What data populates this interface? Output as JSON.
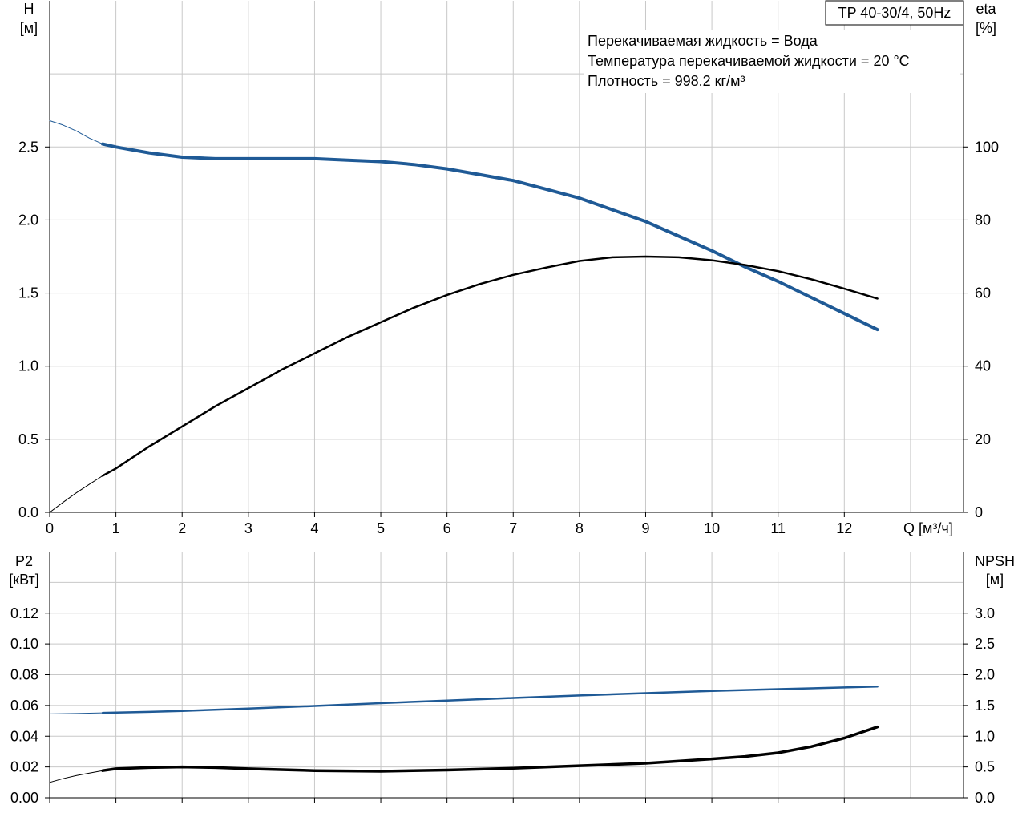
{
  "chart_data": [
    {
      "type": "line",
      "title_box": "TP 40-30/4, 50Hz",
      "notes": [
        "Перекачиваемая жидкость = Вода",
        "Температура перекачиваемой жидкости = 20 °C",
        "Плотность = 998.2 кг/м³"
      ],
      "xlabel": "Q [м³/ч]",
      "xlim": [
        0,
        13.8
      ],
      "xticks": [
        0,
        1,
        2,
        3,
        4,
        5,
        6,
        7,
        8,
        9,
        10,
        11,
        12
      ],
      "left_axis": {
        "label_top": "H",
        "label_unit": "[м]",
        "lim": [
          0,
          3.5
        ],
        "ticks": [
          "0.0",
          "0.5",
          "1.0",
          "1.5",
          "2.0",
          "2.5"
        ],
        "tick_values": [
          0,
          0.5,
          1.0,
          1.5,
          2.0,
          2.5
        ]
      },
      "right_axis": {
        "label_top": "eta",
        "label_unit": "[%]",
        "lim": [
          0,
          140
        ],
        "ticks": [
          "0",
          "20",
          "40",
          "60",
          "80",
          "100"
        ],
        "tick_values": [
          0,
          20,
          40,
          60,
          80,
          100
        ]
      },
      "grid": true,
      "series": [
        {
          "axis": "left",
          "color": "#1f5a96",
          "width": 4,
          "x": [
            0.8,
            1.0,
            1.5,
            2.0,
            2.5,
            3.0,
            3.5,
            4.0,
            4.5,
            5.0,
            5.5,
            6.0,
            6.5,
            7.0,
            7.5,
            8.0,
            8.5,
            9.0,
            9.5,
            10.0,
            10.5,
            11.0,
            11.5,
            12.0,
            12.5
          ],
          "values": [
            2.52,
            2.5,
            2.46,
            2.43,
            2.42,
            2.42,
            2.42,
            2.42,
            2.41,
            2.4,
            2.38,
            2.35,
            2.31,
            2.27,
            2.21,
            2.15,
            2.07,
            1.99,
            1.89,
            1.79,
            1.68,
            1.58,
            1.47,
            1.36,
            1.25
          ]
        },
        {
          "axis": "left",
          "color": "#1f5a96",
          "width": 1,
          "x": [
            0,
            0.2,
            0.4,
            0.6,
            0.8
          ],
          "values": [
            2.68,
            2.65,
            2.61,
            2.56,
            2.52
          ]
        },
        {
          "axis": "right",
          "color": "#000000",
          "width": 2.5,
          "x": [
            0.8,
            1.0,
            1.5,
            2.0,
            2.5,
            3.0,
            3.5,
            4.0,
            4.5,
            5.0,
            5.5,
            6.0,
            6.5,
            7.0,
            7.5,
            8.0,
            8.5,
            9.0,
            9.5,
            10.0,
            10.5,
            11.0,
            11.5,
            12.0,
            12.5
          ],
          "values": [
            10,
            12,
            18,
            23.5,
            29,
            34,
            39,
            43.5,
            48,
            52,
            56,
            59.5,
            62.5,
            65,
            67,
            68.8,
            69.8,
            70.0,
            69.8,
            69,
            67.7,
            66,
            63.8,
            61.2,
            58.5
          ]
        },
        {
          "axis": "right",
          "color": "#000000",
          "width": 1,
          "x": [
            0,
            0.2,
            0.4,
            0.6,
            0.8
          ],
          "values": [
            0,
            2.7,
            5.3,
            7.7,
            10
          ]
        }
      ]
    },
    {
      "type": "line",
      "xlim": [
        0,
        13.8
      ],
      "xticks": [
        0,
        1,
        2,
        3,
        4,
        5,
        6,
        7,
        8,
        9,
        10,
        11,
        12
      ],
      "left_axis": {
        "label_top": "P2",
        "label_unit": "[кВт]",
        "lim": [
          0,
          0.16
        ],
        "ticks": [
          "0.00",
          "0.02",
          "0.04",
          "0.06",
          "0.08",
          "0.10",
          "0.12"
        ],
        "tick_values": [
          0,
          0.02,
          0.04,
          0.06,
          0.08,
          0.1,
          0.12
        ]
      },
      "right_axis": {
        "label_top": "NPSH",
        "label_unit": "[м]",
        "lim": [
          0,
          4.0
        ],
        "ticks": [
          "0.0",
          "0.5",
          "1.0",
          "1.5",
          "2.0",
          "2.5",
          "3.0"
        ],
        "tick_values": [
          0,
          0.5,
          1.0,
          1.5,
          2.0,
          2.5,
          3.0
        ]
      },
      "grid": true,
      "series": [
        {
          "axis": "left",
          "color": "#1f5a96",
          "width": 2.5,
          "x": [
            0.8,
            1.5,
            2.0,
            3.0,
            4.0,
            5.0,
            6.0,
            7.0,
            8.0,
            9.0,
            10.0,
            11.0,
            12.0,
            12.5
          ],
          "values": [
            0.0552,
            0.0558,
            0.0564,
            0.058,
            0.0597,
            0.0615,
            0.0632,
            0.0649,
            0.0665,
            0.068,
            0.0694,
            0.0706,
            0.0717,
            0.0723
          ]
        },
        {
          "axis": "left",
          "color": "#1f5a96",
          "width": 1,
          "x": [
            0,
            0.4,
            0.8
          ],
          "values": [
            0.0545,
            0.0548,
            0.0552
          ]
        },
        {
          "axis": "right",
          "color": "#000000",
          "width": 3.5,
          "x": [
            0.8,
            1.0,
            1.5,
            2.0,
            2.5,
            3.0,
            4.0,
            5.0,
            6.0,
            7.0,
            8.0,
            9.0,
            10.0,
            10.5,
            11.0,
            11.5,
            12.0,
            12.5
          ],
          "values": [
            0.44,
            0.47,
            0.49,
            0.5,
            0.49,
            0.47,
            0.44,
            0.43,
            0.45,
            0.48,
            0.52,
            0.56,
            0.63,
            0.67,
            0.73,
            0.83,
            0.97,
            1.15
          ]
        },
        {
          "axis": "right",
          "color": "#000000",
          "width": 1,
          "x": [
            0,
            0.2,
            0.4,
            0.6,
            0.8
          ],
          "values": [
            0.25,
            0.31,
            0.36,
            0.4,
            0.44
          ]
        }
      ]
    }
  ]
}
